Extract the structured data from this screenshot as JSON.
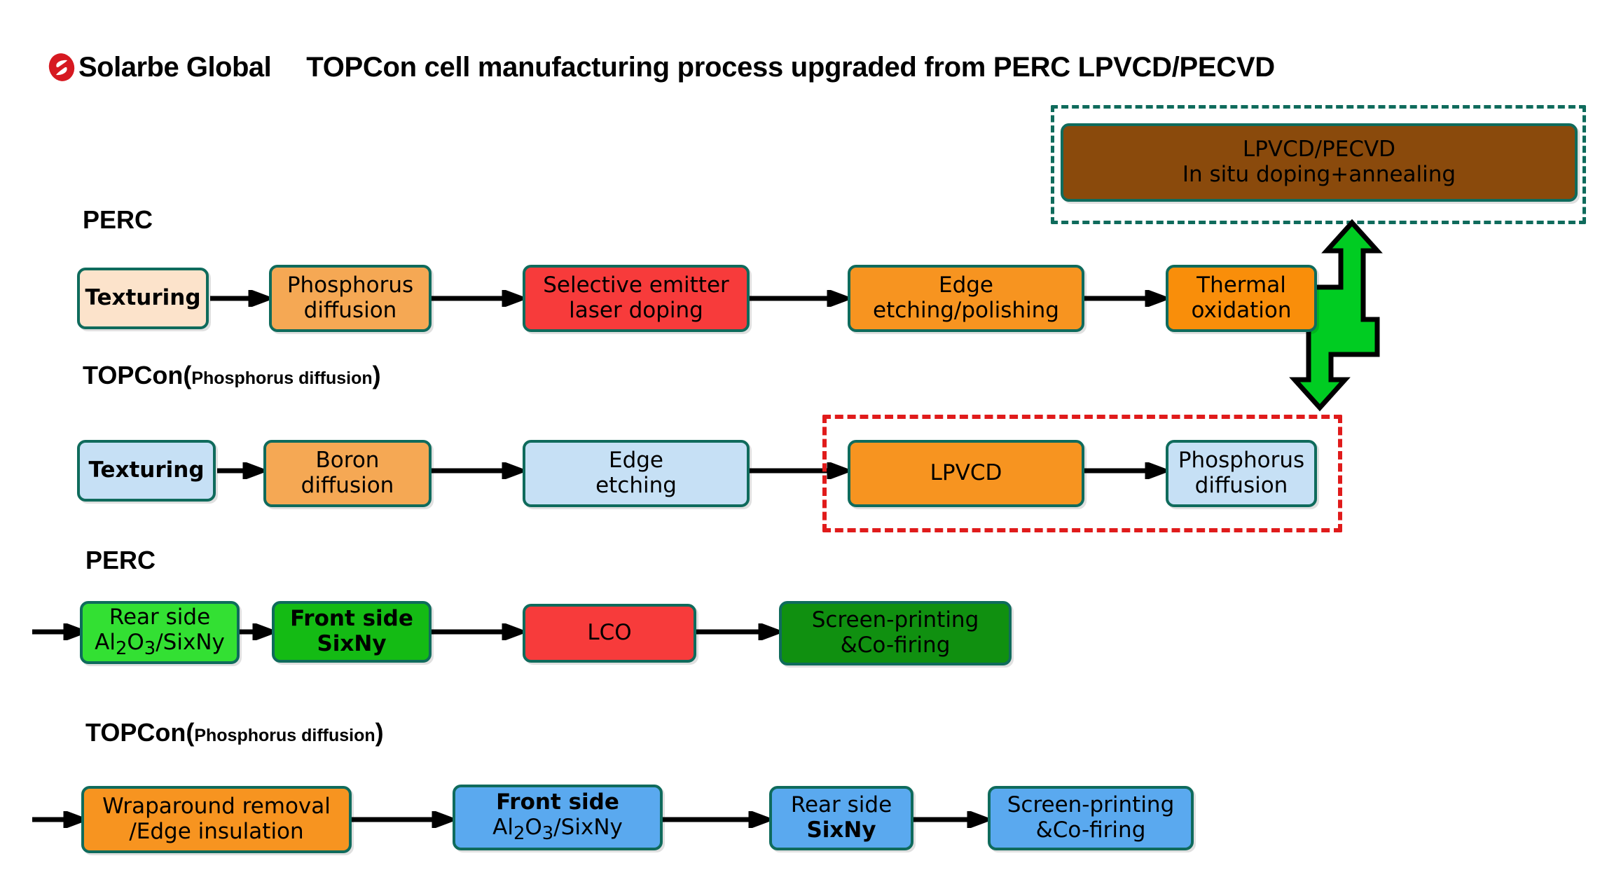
{
  "header": {
    "logo_icon": "solarbe-logo-icon",
    "brand": "Solarbe Global",
    "title": "TOPCon cell manufacturing process upgraded from PERC LPVCD/PECVD"
  },
  "labels": {
    "perc_row1": "PERC",
    "topcon_row2_main": "TOPCon(",
    "topcon_row2_sub": "Phosphorus diffusion",
    "topcon_row2_close": ")",
    "perc_row3": "PERC",
    "topcon_row4_main": "TOPCon(",
    "topcon_row4_sub": "Phosphorus diffusion",
    "topcon_row4_close": ")"
  },
  "top_box": {
    "line1": "LPVCD/PECVD",
    "line2": "In situ doping+annealing",
    "fill": "#8a4a0c",
    "border": "#0f6b5c",
    "dashed_border": "#0f6b5c"
  },
  "green_arrow": {
    "name": "bidirectional-process-link-arrow",
    "fill": "#00cc22",
    "stroke": "#000000"
  },
  "red_dashed_group": {
    "border": "#e01b1b"
  },
  "colors": {
    "box_border": "#0f6b5c",
    "cream": "#fce3cb",
    "orange_light": "#f5a854",
    "orange": "#f79420",
    "orange_deep": "#f98e0a",
    "red": "#f73b3b",
    "light_blue": "#c6e0f5",
    "blue": "#5aa9ef",
    "green_bright": "#33e033",
    "green_mid": "#14bb14",
    "green_dark": "#109010",
    "brown": "#8a4a0c"
  },
  "rows": [
    {
      "id": "perc-front-end",
      "label": "PERC",
      "boxes": [
        {
          "name": "texturing",
          "lines": [
            {
              "text": "Texturing",
              "bold": true
            }
          ],
          "fill": "#fce3cb"
        },
        {
          "name": "phosphorus-diffusion",
          "lines": [
            {
              "text": "Phosphorus",
              "bold": false
            },
            {
              "text": "diffusion",
              "bold": false
            }
          ],
          "fill": "#f5a854"
        },
        {
          "name": "selective-emitter-laser-doping",
          "lines": [
            {
              "text": "Selective emitter",
              "bold": false
            },
            {
              "text": "laser doping",
              "bold": false
            }
          ],
          "fill": "#f73b3b"
        },
        {
          "name": "edge-etching-polishing",
          "lines": [
            {
              "text": "Edge",
              "bold": false
            },
            {
              "text": "etching/polishing",
              "bold": false
            }
          ],
          "fill": "#f79420"
        },
        {
          "name": "thermal-oxidation",
          "lines": [
            {
              "text": "Thermal",
              "bold": false
            },
            {
              "text": "oxidation",
              "bold": false
            }
          ],
          "fill": "#f98e0a"
        }
      ]
    },
    {
      "id": "topcon-front-end",
      "label": "TOPCon(Phosphorus diffusion)",
      "boxes": [
        {
          "name": "texturing",
          "lines": [
            {
              "text": "Texturing",
              "bold": true
            }
          ],
          "fill": "#c6e0f5"
        },
        {
          "name": "boron-diffusion",
          "lines": [
            {
              "text": "Boron",
              "bold": false
            },
            {
              "text": "diffusion",
              "bold": false
            }
          ],
          "fill": "#f5a854"
        },
        {
          "name": "edge-etching",
          "lines": [
            {
              "text": "Edge",
              "bold": false
            },
            {
              "text": "etching",
              "bold": false
            }
          ],
          "fill": "#c6e0f5"
        },
        {
          "name": "lpvcd",
          "lines": [
            {
              "text": "LPVCD",
              "bold": false
            }
          ],
          "fill": "#f79420"
        },
        {
          "name": "phosphorus-diffusion",
          "lines": [
            {
              "text": "Phosphorus",
              "bold": false
            },
            {
              "text": "diffusion",
              "bold": false
            }
          ],
          "fill": "#c6e0f5"
        }
      ]
    },
    {
      "id": "perc-back-end",
      "label": "PERC",
      "boxes": [
        {
          "name": "rear-side-al2o3-sixny",
          "lines": [
            {
              "text": "Rear side",
              "bold": false
            },
            {
              "text": "Al2O3/SixNy",
              "bold": false
            }
          ],
          "fill": "#33e033"
        },
        {
          "name": "front-side-sixny",
          "lines": [
            {
              "text": "Front side",
              "bold": true
            },
            {
              "text": "SixNy",
              "bold": true
            }
          ],
          "fill": "#14bb14"
        },
        {
          "name": "lco",
          "lines": [
            {
              "text": "LCO",
              "bold": false
            }
          ],
          "fill": "#f73b3b"
        },
        {
          "name": "screen-printing-co-firing",
          "lines": [
            {
              "text": "Screen-printing",
              "bold": false
            },
            {
              "text": "&Co-firing",
              "bold": false
            }
          ],
          "fill": "#109010"
        }
      ]
    },
    {
      "id": "topcon-back-end",
      "label": "TOPCon(Phosphorus diffusion)",
      "boxes": [
        {
          "name": "wraparound-removal-edge-insulation",
          "lines": [
            {
              "text": "Wraparound removal",
              "bold": false
            },
            {
              "text": "/Edge insulation",
              "bold": false
            }
          ],
          "fill": "#f79420"
        },
        {
          "name": "front-side-al2o3-sixny",
          "lines": [
            {
              "text": "Front side",
              "bold": true
            },
            {
              "text": "Al2O3/SixNy",
              "bold": false
            }
          ],
          "fill": "#5aa9ef"
        },
        {
          "name": "rear-side-sixny",
          "lines": [
            {
              "text": "Rear side",
              "bold": false
            },
            {
              "text": "SixNy",
              "bold": true
            }
          ],
          "fill": "#5aa9ef"
        },
        {
          "name": "screen-printing-co-firing",
          "lines": [
            {
              "text": "Screen-printing",
              "bold": false
            },
            {
              "text": "&Co-firing",
              "bold": false
            }
          ],
          "fill": "#5aa9ef"
        }
      ]
    }
  ],
  "box_text": {
    "texturing": "Texturing",
    "phosphorus": "Phosphorus",
    "diffusion": "diffusion",
    "selective_emitter": "Selective emitter",
    "laser_doping": "laser doping",
    "edge": "Edge",
    "etching_polishing": "etching/polishing",
    "thermal": "Thermal",
    "oxidation": "oxidation",
    "boron": "Boron",
    "etching": "etching",
    "lpvcd": "LPVCD",
    "rear_side": "Rear side",
    "front_side": "Front side",
    "sixny": "SixNy",
    "lco": "LCO",
    "screen_printing": "Screen-printing",
    "co_firing": "&Co-firing",
    "wraparound_removal": "Wraparound removal",
    "edge_insulation": "/Edge insulation",
    "al2o3_sixny_pre": "Al",
    "al2o3_sub1": "2",
    "al2o3_mid": "O",
    "al2o3_sub2": "3",
    "al2o3_post": "/SixNy"
  }
}
